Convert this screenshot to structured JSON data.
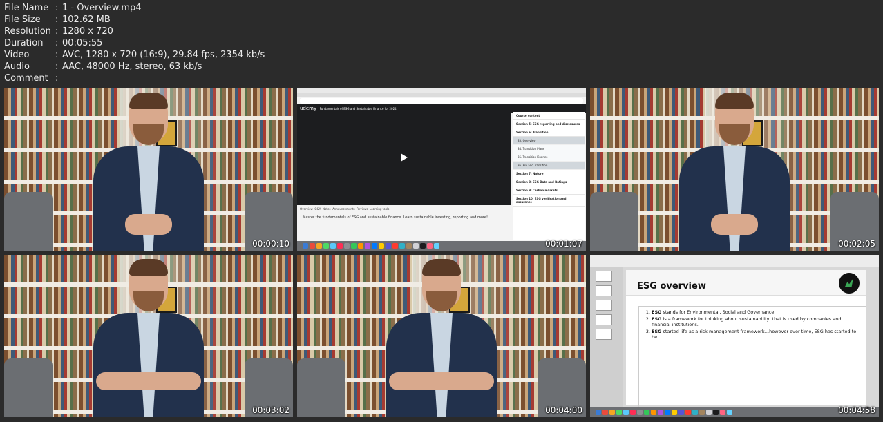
{
  "file_info": [
    {
      "key": "File Name",
      "value": "1 - Overview.mp4"
    },
    {
      "key": "File Size",
      "value": "102.62 MB"
    },
    {
      "key": "Resolution",
      "value": "1280 x 720"
    },
    {
      "key": "Duration",
      "value": "00:05:55"
    },
    {
      "key": "Video",
      "value": "AVC, 1280 x 720 (16:9), 29.84 fps, 2354 kb/s"
    },
    {
      "key": "Audio",
      "value": "AAC, 48000 Hz, stereo, 63 kb/s"
    },
    {
      "key": "Comment",
      "value": ""
    }
  ],
  "separator": ":",
  "thumbnails": [
    {
      "kind": "speaker",
      "timestamp": "00:00:10"
    },
    {
      "kind": "browser",
      "timestamp": "00:01:07"
    },
    {
      "kind": "speaker",
      "timestamp": "00:02:05"
    },
    {
      "kind": "speaker-gesture",
      "timestamp": "00:03:02"
    },
    {
      "kind": "speaker-gesture",
      "timestamp": "00:04:00"
    },
    {
      "kind": "slides",
      "timestamp": "00:04:58"
    }
  ],
  "browser_frame": {
    "site": "udemy",
    "course_title": "Fundamentals of ESG and Sustainable Finance for 2024",
    "panel_title": "Course content",
    "sections": [
      "Section 5: ESG reporting and disclosures",
      "Section 6: Transition",
      "Section 7: Nature",
      "Section 8: ESG Data and Ratings",
      "Section 9: Carbon markets",
      "Section 10: ESG verification and assurance"
    ],
    "lectures": [
      "33. Overview",
      "34. Transition Plans",
      "35. Transition Finance",
      "36. Pre and Transition"
    ],
    "tabs": [
      "Overview",
      "Q&A",
      "Notes",
      "Announcements",
      "Reviews",
      "Learning tools"
    ],
    "description": "Master the fundamentals of ESG and sustainable finance. Learn sustainable investing, reporting and more!"
  },
  "slides_frame": {
    "title": "ESG overview",
    "items": [
      {
        "bold": "ESG",
        "text": " stands for Environmental, Social and Governance."
      },
      {
        "bold": "ESG",
        "text": " is a framework for thinking about sustainability, that is used by companies and financial institutions."
      },
      {
        "bold": "ESG",
        "text": " started life as a risk management framework…however over time, ESG has started to be"
      }
    ]
  },
  "colors": {
    "background": "#2b2b2b",
    "text": "#eaeaea",
    "udemy_dark": "#1c1d1f",
    "jacket": "#22314c"
  }
}
